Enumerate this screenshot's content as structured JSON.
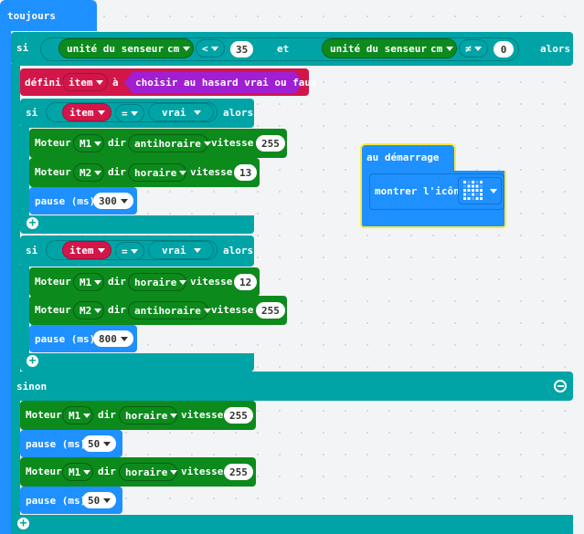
{
  "forever": {
    "label": "toujours"
  },
  "outer_if": {
    "si": "si",
    "alors": "alors",
    "sinon": "sinon",
    "cond_left": {
      "label": "unité du senseur",
      "unit": "cm"
    },
    "op1": "<",
    "val1": "35",
    "and": "et",
    "cond_right": {
      "label": "unité du senseur",
      "unit": "cm"
    },
    "op2": "≠",
    "val2": "0"
  },
  "set_item": {
    "label": "définir",
    "var": "item",
    "to": "à",
    "value": "choisir au hasard vrai ou faux"
  },
  "if1": {
    "si": "si",
    "var": "item",
    "op": "=",
    "value": "vrai",
    "alors": "alors"
  },
  "if2": {
    "si": "si",
    "var": "item",
    "op": "=",
    "value": "vrai",
    "alors": "alors"
  },
  "motors": [
    {
      "label": "Moteur",
      "motor": "M1",
      "dir_label": "dir",
      "direction": "antihoraire",
      "speed_label": "vitesse",
      "speed": "255"
    },
    {
      "label": "Moteur",
      "motor": "M2",
      "dir_label": "dir",
      "direction": "horaire",
      "speed_label": "vitesse",
      "speed": "13"
    },
    {
      "label": "Moteur",
      "motor": "M1",
      "dir_label": "dir",
      "direction": "horaire",
      "speed_label": "vitesse",
      "speed": "12"
    },
    {
      "label": "Moteur",
      "motor": "M2",
      "dir_label": "dir",
      "direction": "antihoraire",
      "speed_label": "vitesse",
      "speed": "255"
    },
    {
      "label": "Moteur",
      "motor": "M1",
      "dir_label": "dir",
      "direction": "horaire",
      "speed_label": "vitesse",
      "speed": "255"
    },
    {
      "label": "Moteur",
      "motor": "M1",
      "dir_label": "dir",
      "direction": "horaire",
      "speed_label": "vitesse",
      "speed": "255"
    }
  ],
  "pauses": [
    {
      "label": "pause (ms)",
      "value": "300"
    },
    {
      "label": "pause (ms)",
      "value": "800"
    },
    {
      "label": "pause (ms)",
      "value": "50"
    },
    {
      "label": "pause (ms)",
      "value": "50"
    }
  ],
  "on_start": {
    "label": "au démarrage",
    "show_icon": "montrer l'icône",
    "icon": "space-invader-icon"
  },
  "colors": {
    "loops": "#1e90ff",
    "logic": "#00a4a6",
    "motors": "#0c8a1c",
    "variables": "#d2164a",
    "random": "#a01fd2",
    "selection": "#ffeb3b"
  }
}
